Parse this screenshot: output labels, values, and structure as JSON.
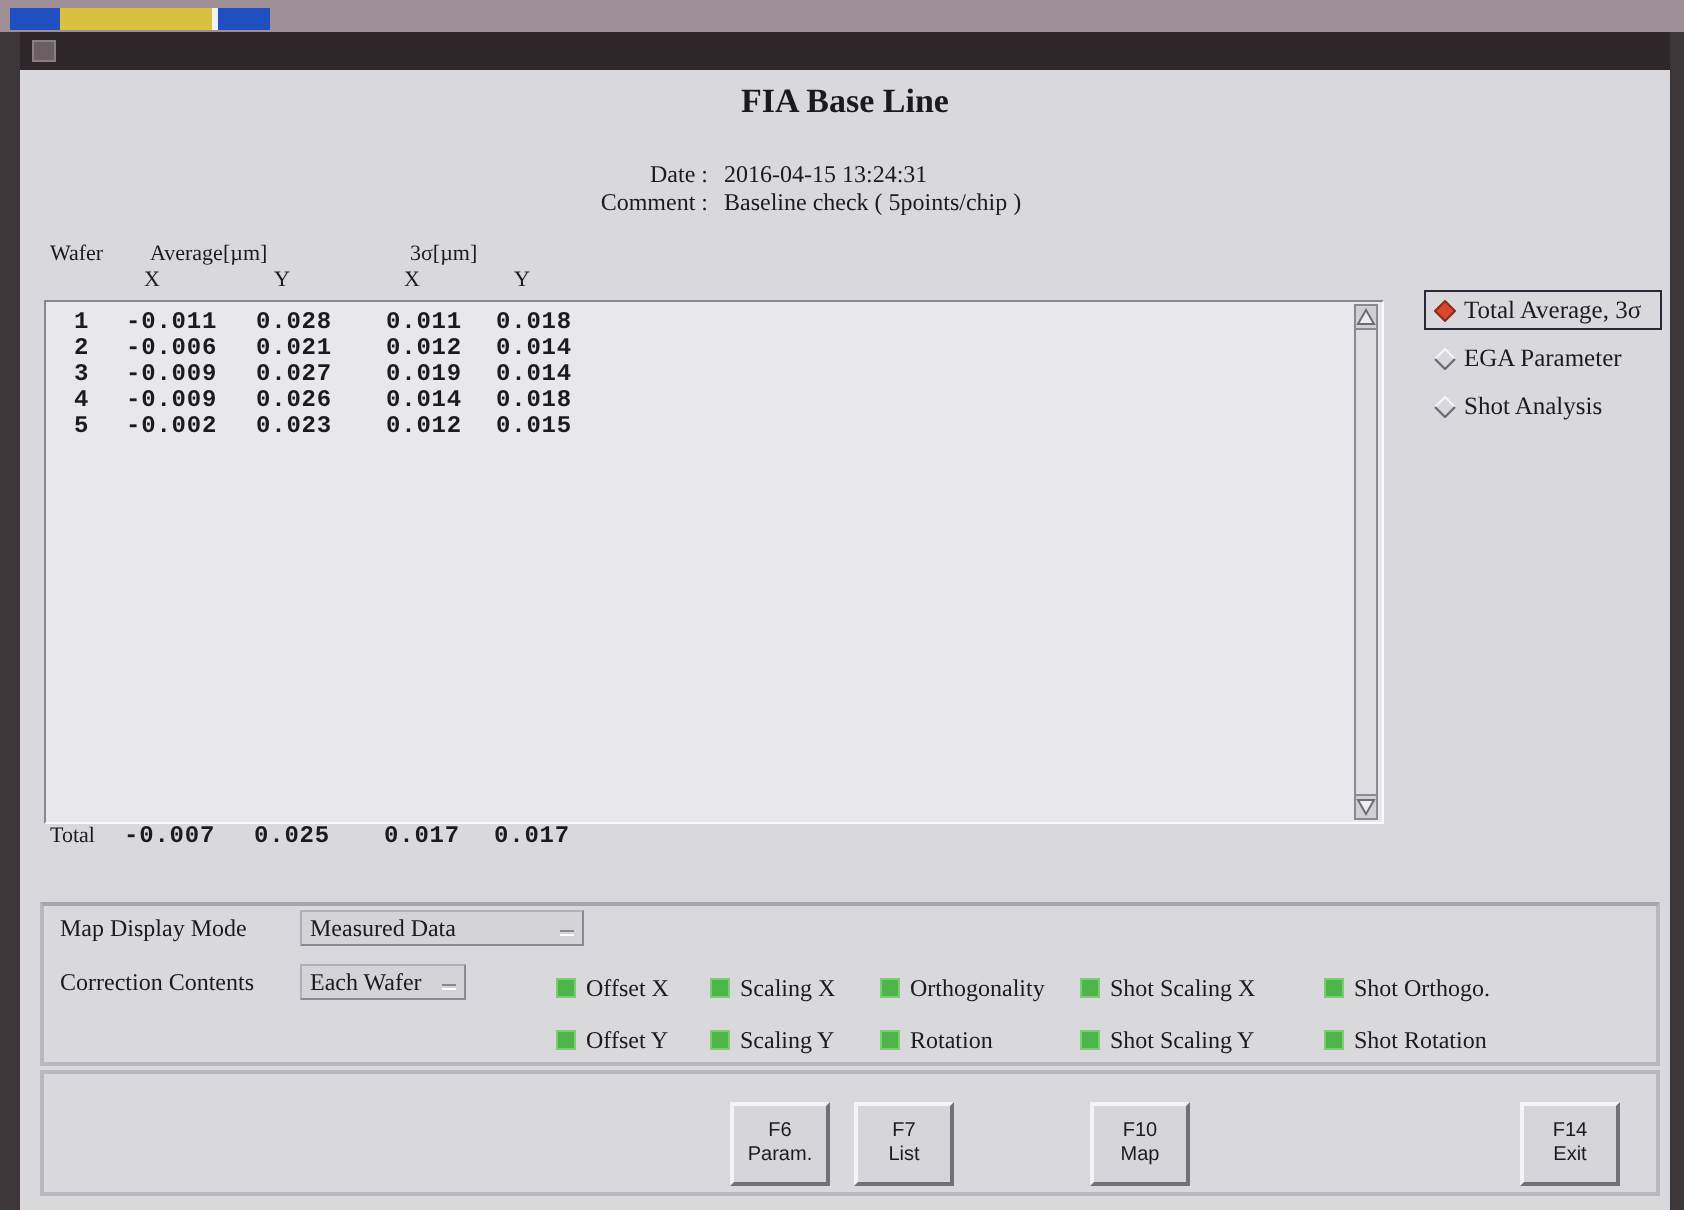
{
  "title": "FIA Base Line",
  "info": [
    {
      "label": "Date :",
      "value": "2016-04-15 13:24:31"
    },
    {
      "label": "Comment :",
      "value": "Baseline check ( 5points/chip )"
    }
  ],
  "table": {
    "group_headers": [
      "Wafer",
      "Average[µm]",
      "3σ[µm]"
    ],
    "columns": [
      "",
      "X",
      "Y",
      "X",
      "Y"
    ],
    "rows": [
      [
        "1",
        "-0.011",
        "0.028",
        "0.011",
        "0.018"
      ],
      [
        "2",
        "-0.006",
        "0.021",
        "0.012",
        "0.014"
      ],
      [
        "3",
        "-0.009",
        "0.027",
        "0.019",
        "0.014"
      ],
      [
        "4",
        "-0.009",
        "0.026",
        "0.014",
        "0.018"
      ],
      [
        "5",
        "-0.002",
        "0.023",
        "0.012",
        "0.015"
      ]
    ],
    "total": {
      "label": "Total",
      "values": [
        "-0.007",
        "0.025",
        "0.017",
        "0.017"
      ]
    }
  },
  "views": [
    {
      "label": "Total Average, 3σ",
      "selected": true
    },
    {
      "label": "EGA Parameter",
      "selected": false
    },
    {
      "label": "Shot Analysis",
      "selected": false
    }
  ],
  "map_display_mode": {
    "label": "Map Display Mode",
    "value": "Measured Data"
  },
  "correction_contents": {
    "label": "Correction Contents",
    "value": "Each Wafer"
  },
  "corrections": [
    {
      "label": "Offset X",
      "checked": true
    },
    {
      "label": "Scaling X",
      "checked": true
    },
    {
      "label": "Orthogonality",
      "checked": true
    },
    {
      "label": "Shot Scaling X",
      "checked": true
    },
    {
      "label": "Shot Orthogo.",
      "checked": true
    },
    {
      "label": "Offset Y",
      "checked": true
    },
    {
      "label": "Scaling Y",
      "checked": true
    },
    {
      "label": "Rotation",
      "checked": true
    },
    {
      "label": "Shot Scaling Y",
      "checked": true
    },
    {
      "label": "Shot Rotation",
      "checked": true
    }
  ],
  "function_keys": [
    {
      "key": "F6",
      "label": "Param."
    },
    {
      "key": "F7",
      "label": "List"
    },
    {
      "key": "F10",
      "label": "Map"
    },
    {
      "key": "F14",
      "label": "Exit"
    }
  ]
}
